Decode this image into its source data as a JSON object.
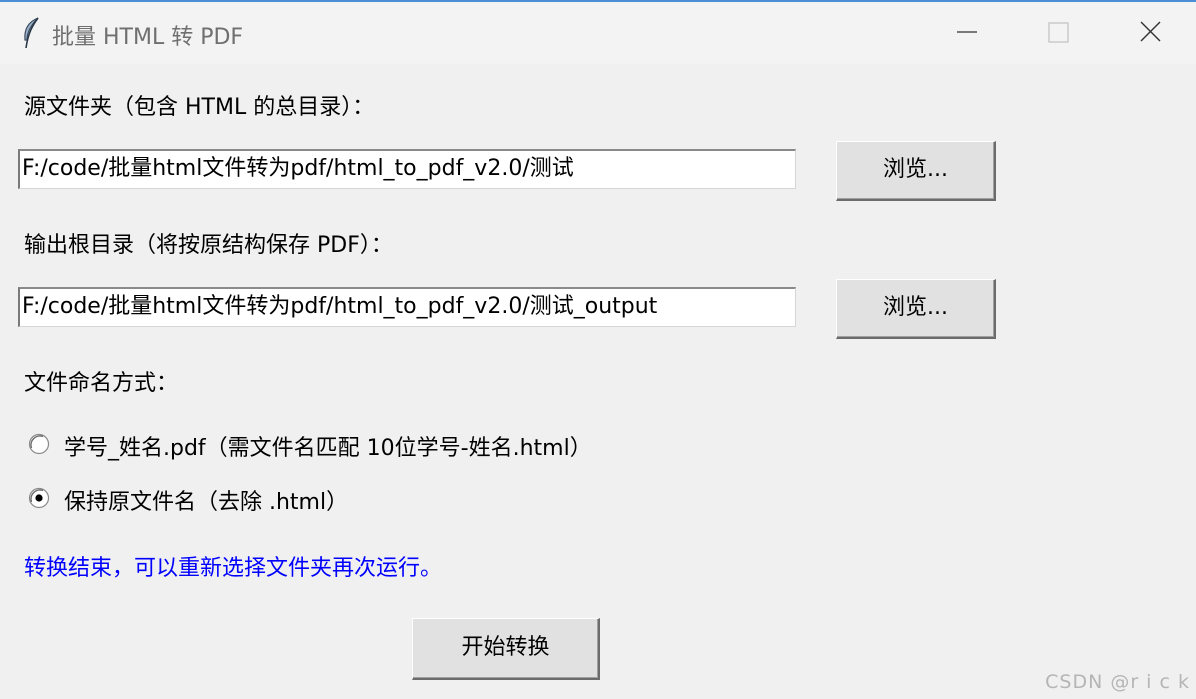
{
  "window": {
    "title": "批量 HTML 转 PDF",
    "icon": "feather-icon"
  },
  "source": {
    "label": "源文件夹（包含 HTML 的总目录）：",
    "value": "F:/code/批量html文件转为pdf/html_to_pdf_v2.0/测试",
    "browse_label": "浏览..."
  },
  "output": {
    "label": "输出根目录（将按原结构保存 PDF）：",
    "value": "F:/code/批量html文件转为pdf/html_to_pdf_v2.0/测试_output",
    "browse_label": "浏览..."
  },
  "naming": {
    "label": "文件命名方式：",
    "options": [
      {
        "label": "学号_姓名.pdf（需文件名匹配 10位学号-姓名.html）",
        "selected": false
      },
      {
        "label": "保持原文件名（去除 .html）",
        "selected": true
      }
    ]
  },
  "status": {
    "text": "转换结束，可以重新选择文件夹再次运行。",
    "color": "#0000ff"
  },
  "start_button": {
    "label": "开始转换"
  },
  "watermark": "CSDN @r i c k"
}
